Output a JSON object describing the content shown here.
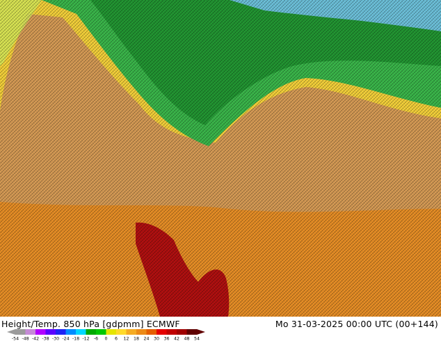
{
  "caption": {
    "title": "Height/Temp. 850 hPa [gdpmm] ECMWF",
    "valid_time": "Mo 31-03-2025 00:00 UTC (00+144)"
  },
  "legend": {
    "ticks": [
      "-54",
      "-48",
      "-42",
      "-38",
      "-30",
      "-24",
      "-18",
      "-12",
      "-6",
      "0",
      "6",
      "12",
      "18",
      "24",
      "30",
      "36",
      "42",
      "48",
      "54"
    ],
    "colors": [
      "#9b9b9b",
      "#c58ad6",
      "#b200ff",
      "#5a00ff",
      "#1e22f5",
      "#008cff",
      "#00d7ff",
      "#00aa00",
      "#00c800",
      "#e5e500",
      "#ffda2a",
      "#f5ab22",
      "#ec8a16",
      "#e55e00",
      "#e50000",
      "#c00000",
      "#a00000",
      "#600000"
    ]
  },
  "map": {
    "regions": [
      {
        "name": "cold-north",
        "color": "#3ab54a"
      },
      {
        "name": "arctic-blue",
        "color": "#6cbfd8"
      },
      {
        "name": "zero-band",
        "color": "#f2cf3a"
      },
      {
        "name": "warm-tan",
        "color": "#d49a55"
      },
      {
        "name": "hot-orange",
        "color": "#e58d26"
      },
      {
        "name": "very-hot",
        "color": "#b01010"
      }
    ]
  }
}
